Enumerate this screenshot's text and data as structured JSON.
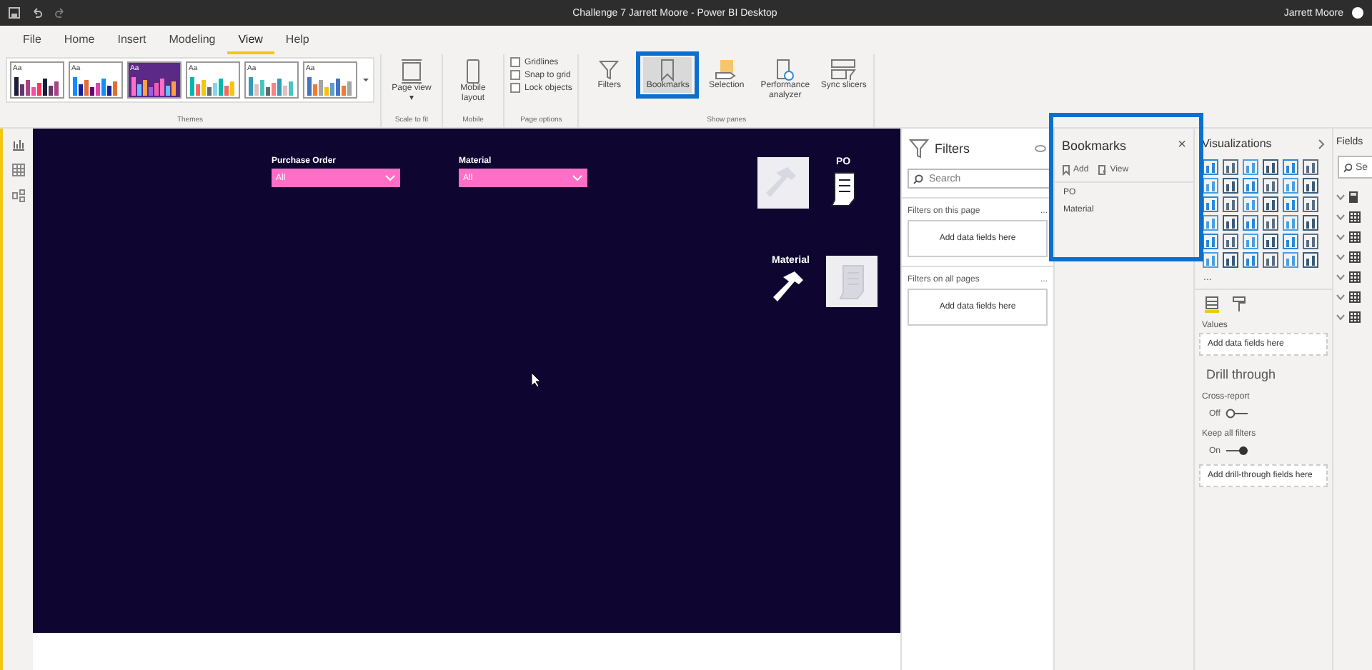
{
  "title_bar": {
    "title": "Challenge 7 Jarrett Moore - Power BI Desktop",
    "user": "Jarrett Moore"
  },
  "menu_tabs": [
    {
      "label": "File",
      "selected": false
    },
    {
      "label": "Home",
      "selected": false
    },
    {
      "label": "Insert",
      "selected": false
    },
    {
      "label": "Modeling",
      "selected": false
    },
    {
      "label": "View",
      "selected": true
    },
    {
      "label": "Help",
      "selected": false
    }
  ],
  "ribbon": {
    "themes": [
      {
        "label": "Aa",
        "selected": false
      },
      {
        "label": "Aa",
        "selected": false
      },
      {
        "label": "Aa",
        "selected": true
      },
      {
        "label": "Aa",
        "selected": false
      },
      {
        "label": "Aa",
        "selected": false
      },
      {
        "label": "Aa",
        "selected": false
      }
    ],
    "themes_label": "Themes",
    "page_view": {
      "label": "Page view",
      "caret": "▾",
      "group": "Scale to fit"
    },
    "mobile": {
      "label": "Mobile layout",
      "group": "Mobile"
    },
    "page_options": {
      "group": "Page options",
      "options": [
        {
          "label": "Gridlines",
          "checked": false
        },
        {
          "label": "Snap to grid",
          "checked": false
        },
        {
          "label": "Lock objects",
          "checked": false
        }
      ]
    },
    "show_panes": {
      "group": "Show panes",
      "buttons": [
        {
          "label": "Filters",
          "selected": false
        },
        {
          "label": "Bookmarks",
          "selected": true
        },
        {
          "label": "Selection",
          "selected": false
        },
        {
          "label": "Performance analyzer",
          "selected": false
        },
        {
          "label": "Sync slicers",
          "selected": false
        }
      ]
    }
  },
  "canvas": {
    "slicers": [
      {
        "title": "Purchase Order",
        "value": "All"
      },
      {
        "title": "Material",
        "value": "All"
      }
    ],
    "nav_buttons": [
      {
        "label": "PO"
      },
      {
        "label": "Material"
      }
    ]
  },
  "filters_pane": {
    "title": "Filters",
    "search_placeholder": "Search",
    "sections": [
      {
        "title": "Filters on this page",
        "more": "...",
        "drop": "Add data fields here"
      },
      {
        "title": "Filters on all pages",
        "more": "...",
        "drop": "Add data fields here"
      }
    ]
  },
  "bookmarks_pane": {
    "title": "Bookmarks",
    "close": "×",
    "actions": [
      "Add",
      "View"
    ],
    "items": [
      "PO",
      "Material"
    ]
  },
  "visualizations_pane": {
    "title": "Visualizations",
    "more": "...",
    "values_label": "Values",
    "values_drop": "Add data fields here",
    "drill_title": "Drill through",
    "toggles": [
      {
        "label": "Cross-report",
        "state": "Off",
        "on": false
      },
      {
        "label": "Keep all filters",
        "state": "On",
        "on": true
      }
    ],
    "drill_drop": "Add drill-through fields here"
  },
  "fields_pane": {
    "title": "Fields",
    "search_placeholder": "Se",
    "tables": [
      {
        "kind": "measure"
      },
      {
        "kind": "table"
      },
      {
        "kind": "table"
      },
      {
        "kind": "table"
      },
      {
        "kind": "table"
      },
      {
        "kind": "table"
      },
      {
        "kind": "table"
      }
    ]
  }
}
